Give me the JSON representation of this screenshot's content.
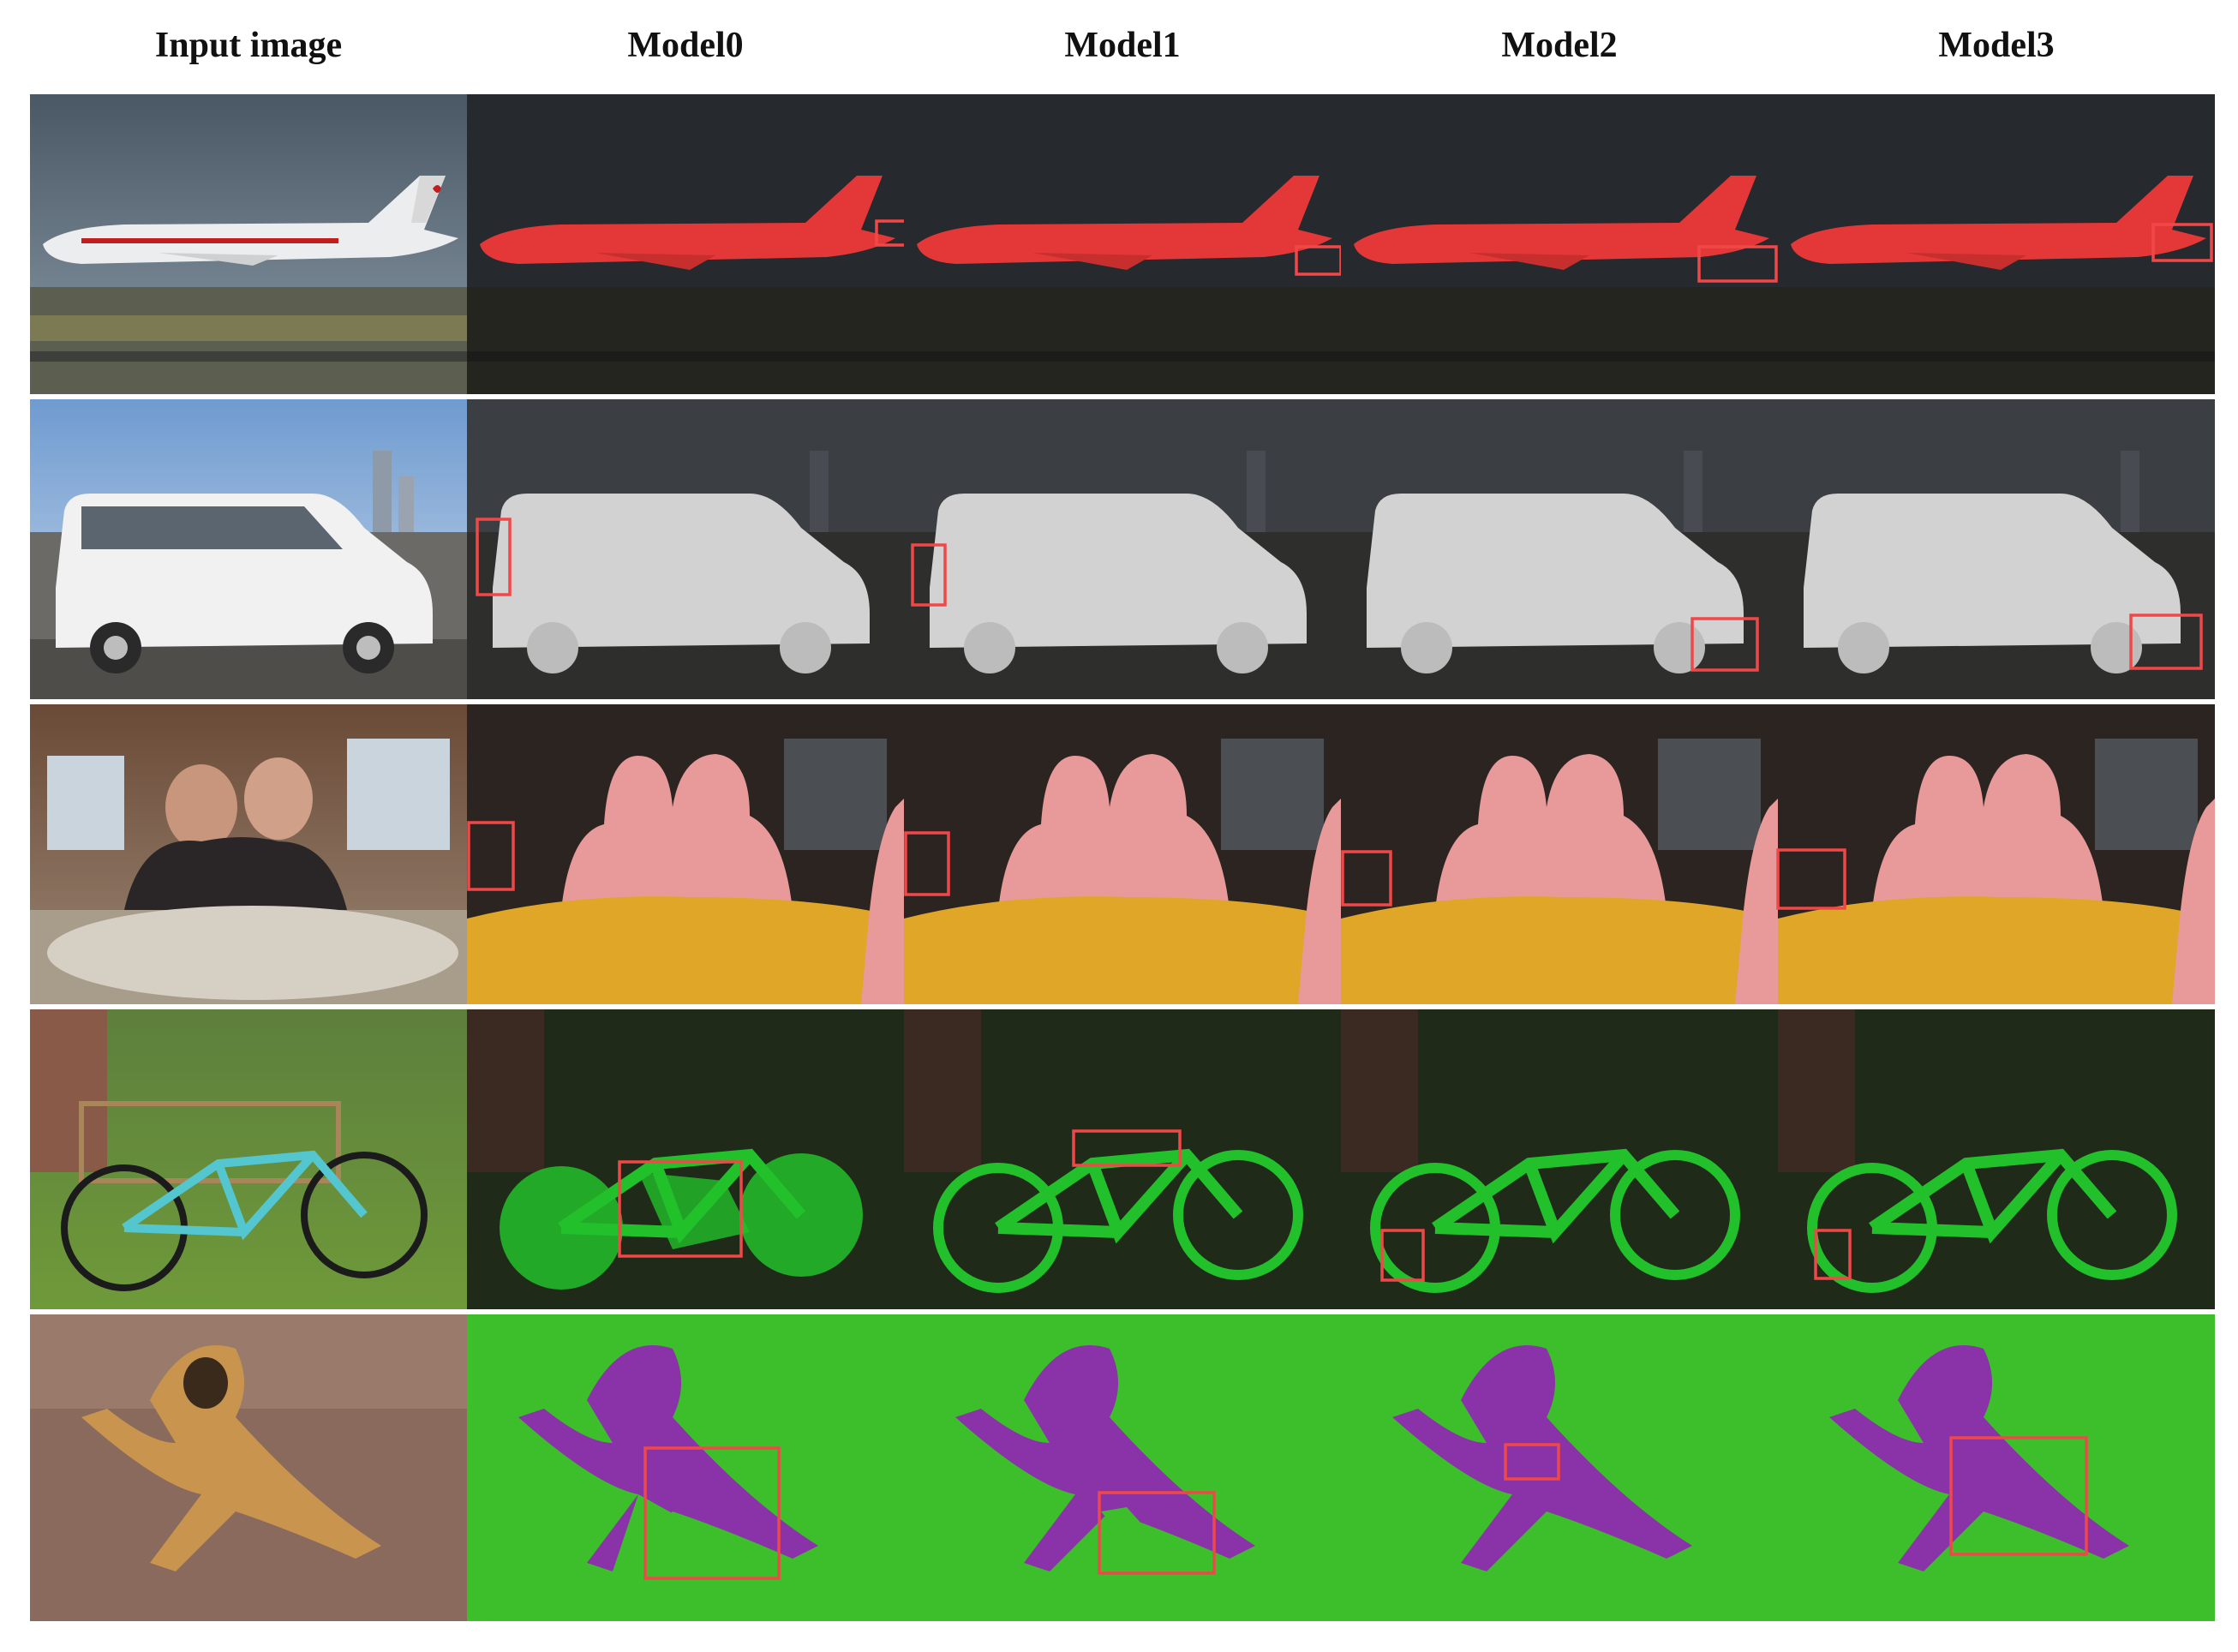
{
  "columns": [
    "Input image",
    "Model0",
    "Model1",
    "Model2",
    "Model3"
  ],
  "rows": [
    {
      "scene": "airplane",
      "mask_color": "#e43838"
    },
    {
      "scene": "van",
      "mask_color": "#d2d2d2"
    },
    {
      "scene": "people-at-table",
      "mask_color": "#e89a9a"
    },
    {
      "scene": "bicycle",
      "mask_color": "#22c02a"
    },
    {
      "scene": "dog",
      "mask_color": "#8a32a8"
    }
  ],
  "highlight_color": "#f04848",
  "background_mask_color": "#3cbf2a",
  "table_mask_color": "#e0a628"
}
